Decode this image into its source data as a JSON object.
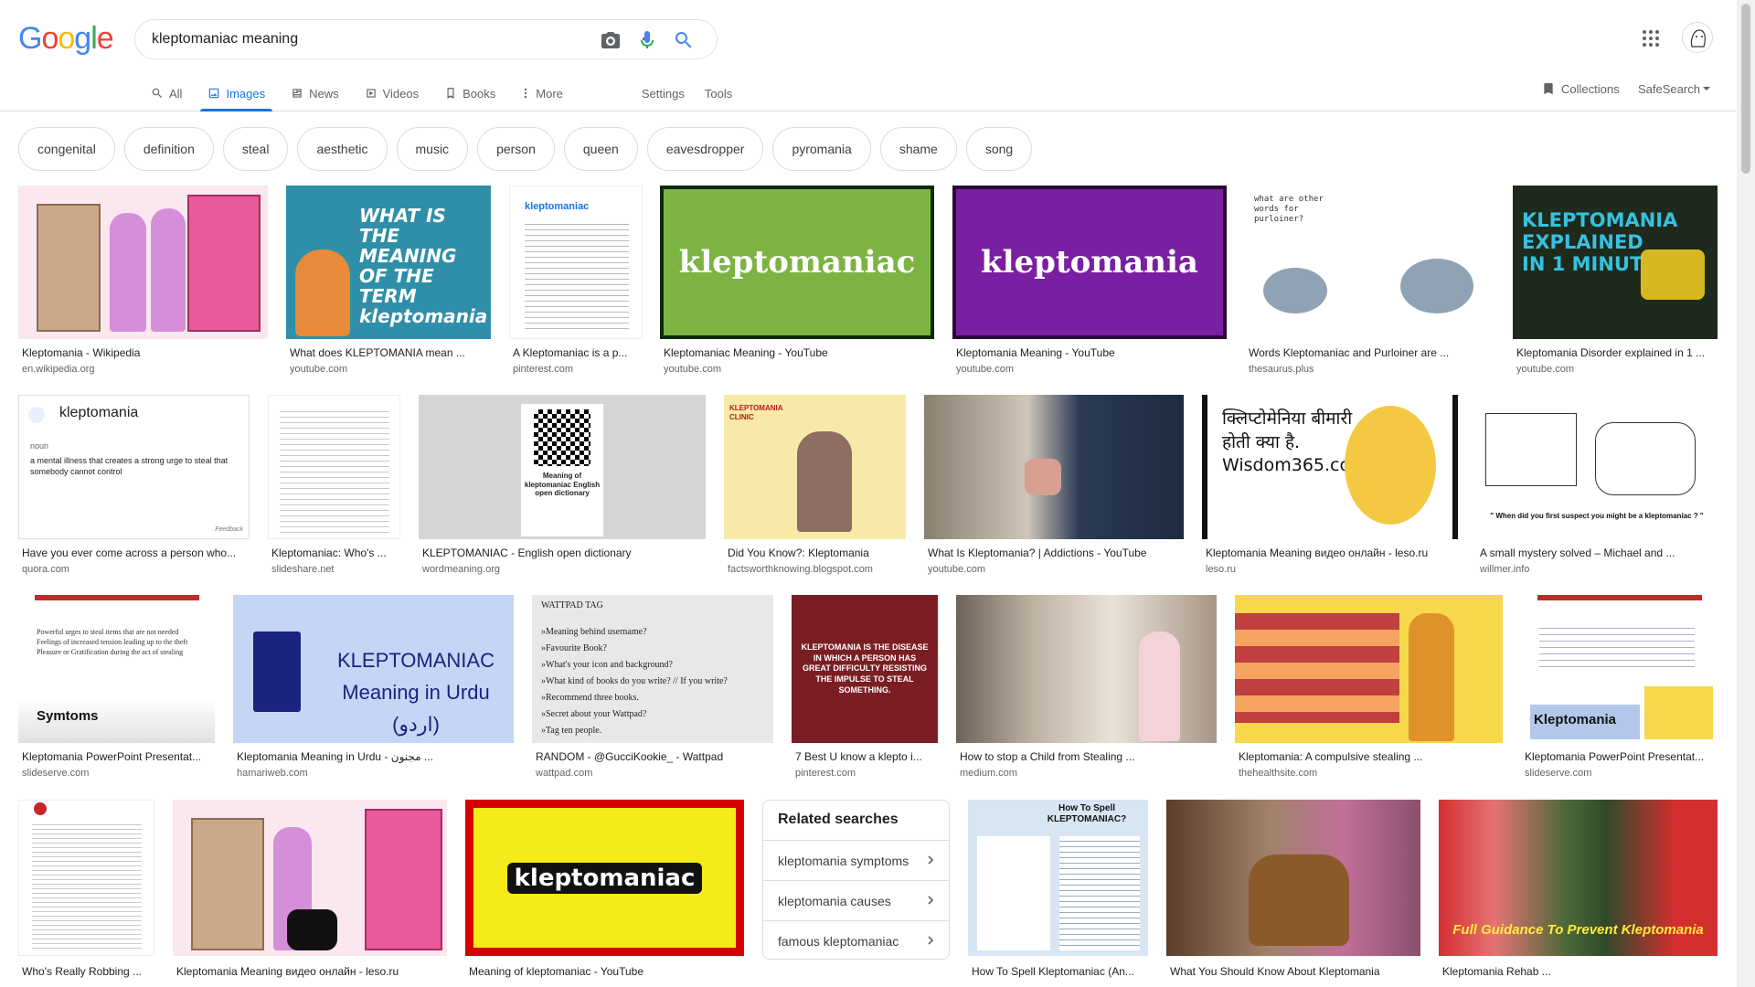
{
  "search": {
    "query": "kleptomaniac meaning"
  },
  "logo": {
    "text": "Google"
  },
  "tabs": [
    {
      "label": "All",
      "icon": "search-icon"
    },
    {
      "label": "Images",
      "icon": "image-icon",
      "active": true
    },
    {
      "label": "News",
      "icon": "news-icon"
    },
    {
      "label": "Videos",
      "icon": "video-icon"
    },
    {
      "label": "Books",
      "icon": "book-icon"
    },
    {
      "label": "More",
      "icon": "more-icon"
    }
  ],
  "tools": {
    "settings": "Settings",
    "tools": "Tools"
  },
  "right_controls": {
    "collections": "Collections",
    "safesearch": "SafeSearch"
  },
  "chips": [
    "congenital",
    "definition",
    "steal",
    "aesthetic",
    "music",
    "person",
    "queen",
    "eavesdropper",
    "pyromania",
    "shame",
    "song"
  ],
  "results": [
    {
      "title": "Kleptomania - Wikipedia",
      "source": "en.wikipedia.org"
    },
    {
      "title": "What does KLEPTOMANIA mean ...",
      "source": "youtube.com",
      "thumb_text": "WHAT IS THE MEANING OF THE TERM kleptomania"
    },
    {
      "title": "A Kleptomaniac is a p...",
      "source": "pinterest.com",
      "thumb_text": "kleptomaniac"
    },
    {
      "title": "Kleptomaniac Meaning - YouTube",
      "source": "youtube.com",
      "thumb_text": "kleptomaniac"
    },
    {
      "title": "Kleptomania Meaning - YouTube",
      "source": "youtube.com",
      "thumb_text": "kleptomania"
    },
    {
      "title": "Words Kleptomaniac and Purloiner are ...",
      "source": "thesaurus.plus",
      "thumb_text": "what are other words for purloiner?"
    },
    {
      "title": "Kleptomania Disorder explained in 1 ...",
      "source": "youtube.com",
      "thumb_text": "KLEPTOMANIA EXPLAINED IN 1 MINUTE"
    },
    {
      "title": "Have you ever come across a person who...",
      "source": "quora.com",
      "thumb_text": "kleptomania"
    },
    {
      "title": "Kleptomaniac: Who's ...",
      "source": "slideshare.net"
    },
    {
      "title": "KLEPTOMANIAC - English open dictionary",
      "source": "wordmeaning.org",
      "thumb_text": "Meaning of kleptomaniac English open dictionary"
    },
    {
      "title": "Did You Know?: Kleptomania",
      "source": "factsworthknowing.blogspot.com",
      "thumb_text": "KLEPTOMANIA CLINIC"
    },
    {
      "title": "What Is Kleptomania? | Addictions - YouTube",
      "source": "youtube.com"
    },
    {
      "title": "Kleptomania Meaning видео онлайн - leso.ru",
      "source": "leso.ru",
      "thumb_text": "क्लिप्टोमेनिया बीमारी होती क्या है. Wisdom365.co.in"
    },
    {
      "title": "A small mystery solved – Michael and ...",
      "source": "willmer.info",
      "thumb_text": "\" When did you first suspect you might be a kleptomaniac ? \""
    },
    {
      "title": "Kleptomania PowerPoint Presentat...",
      "source": "slideserve.com",
      "thumb_text": "Symtoms"
    },
    {
      "title": "Kleptomania Meaning in Urdu - مجنون ...",
      "source": "hamariweb.com",
      "thumb_text": "KLEPTOMANIAC Meaning in Urdu (اردو)"
    },
    {
      "title": "RANDOM - @GucciKookie_ - Wattpad",
      "source": "wattpad.com",
      "thumb_text": "WATTPAD TAG"
    },
    {
      "title": "7 Best U know a klepto i...",
      "source": "pinterest.com",
      "thumb_text": "KLEPTOMANIA IS THE DISEASE IN WHICH A PERSON HAS GREAT DIFFICULTY RESISTING THE IMPULSE TO STEAL SOMETHING."
    },
    {
      "title": "How to stop a Child from Stealing ...",
      "source": "medium.com"
    },
    {
      "title": "Kleptomania: A compulsive stealing ...",
      "source": "thehealthsite.com"
    },
    {
      "title": "Kleptomania PowerPoint Presentat...",
      "source": "slideserve.com",
      "thumb_text": "Kleptomania"
    },
    {
      "title": "Who's Really Robbing ...",
      "source": ""
    },
    {
      "title": "Kleptomania Meaning видео онлайн - leso.ru",
      "source": ""
    },
    {
      "title": "Meaning of kleptomaniac - YouTube",
      "source": "",
      "thumb_text": "kleptomaniac"
    },
    {
      "title": "How To Spell Kleptomaniac (An...",
      "source": "",
      "thumb_text": "How To Spell KLEPTOMANIAC?"
    },
    {
      "title": "What You Should Know About Kleptomania",
      "source": ""
    },
    {
      "title": "Kleptomania Rehab ...",
      "source": "",
      "thumb_text": "Full Guidance To Prevent Kleptomania"
    }
  ],
  "wattpad_lines": [
    "»Meaning behind username?",
    "»Favourite Book?",
    "»What's your icon and background?",
    "»What kind of books do you write? // If you write?",
    "»Recommend three books.",
    "»Secret about your Wattpad?",
    "»Tag ten people."
  ],
  "ppt_bullets": [
    "Powerful urges to steal items that are not needed",
    "Feelings of increased tension leading up to the theft",
    "Pleasure or Gratification during the act of stealing"
  ],
  "quora_card": {
    "pos": "noun",
    "definition": "a mental illness that creates a strong urge to steal that somebody cannot control",
    "footer": "Feedback"
  },
  "related": {
    "title": "Related searches",
    "items": [
      "kleptomania symptoms",
      "kleptomania causes",
      "famous kleptomaniac"
    ]
  },
  "colors": {
    "accent": "#1a73e8",
    "border": "#dadce0"
  }
}
